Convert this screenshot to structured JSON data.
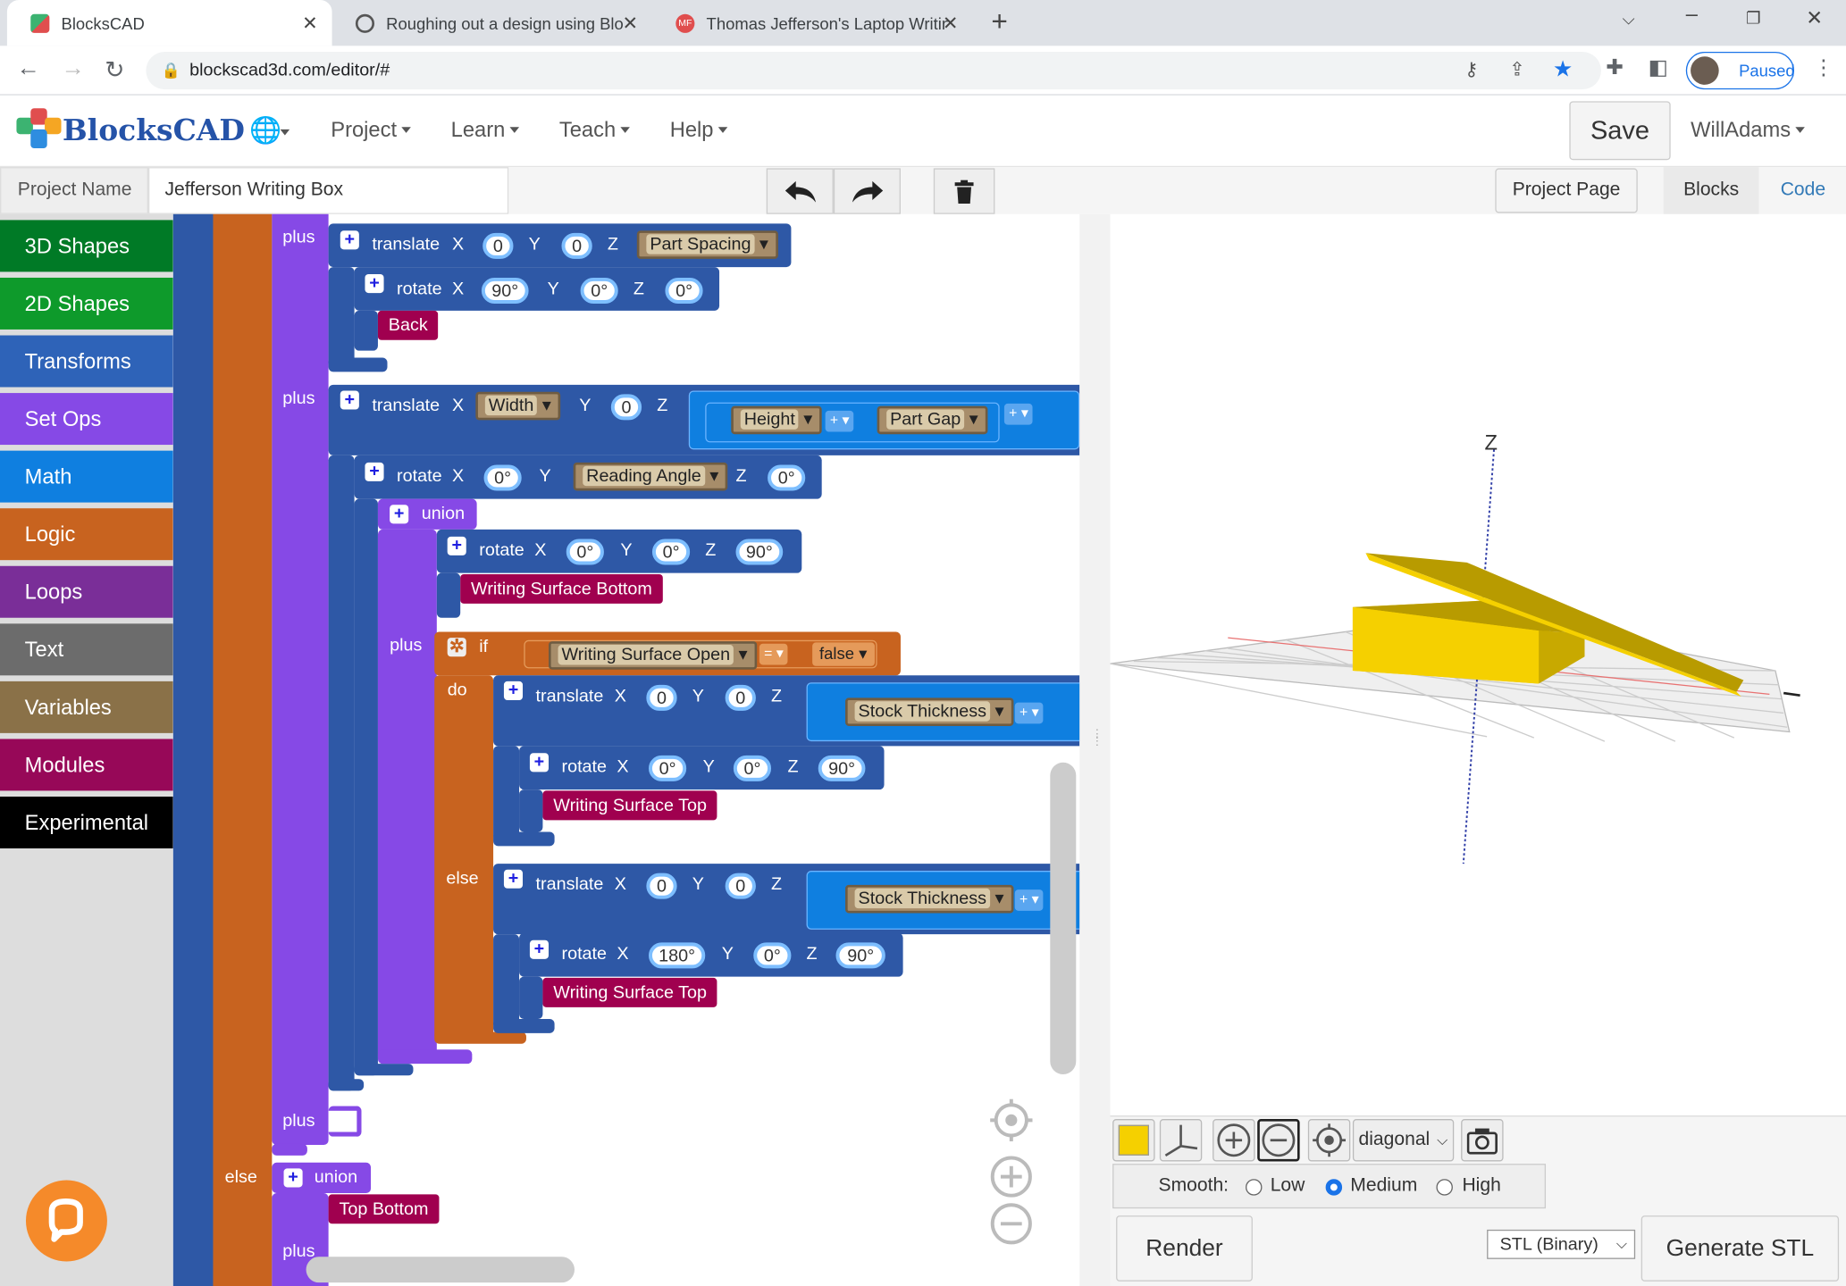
{
  "browser": {
    "tabs": [
      {
        "title": "BlocksCAD",
        "color": "#4c9be8"
      },
      {
        "title": "Roughing out a design using Blo",
        "color": "#777777"
      },
      {
        "title": "Thomas Jefferson's Laptop Writin",
        "color": "#e04e4e"
      }
    ],
    "fav_mf": "MF",
    "url": "blockscad3d.com/editor/#",
    "profile_status": "Paused"
  },
  "app": {
    "logo_text": "BlocksCAD",
    "menu": [
      "Project",
      "Learn",
      "Teach",
      "Help"
    ],
    "save_label": "Save",
    "user": "WillAdams"
  },
  "project": {
    "name_label": "Project Name",
    "name_value": "Jefferson Writing Box",
    "project_page": "Project Page",
    "blocks_tab": "Blocks",
    "code_tab": "Code"
  },
  "toolbox": [
    {
      "label": "3D Shapes",
      "color": "#007a26"
    },
    {
      "label": "2D Shapes",
      "color": "#0e9a2b"
    },
    {
      "label": "Transforms",
      "color": "#2e63b8"
    },
    {
      "label": "Set Ops",
      "color": "#8649e6"
    },
    {
      "label": "Math",
      "color": "#0f7fe0"
    },
    {
      "label": "Logic",
      "color": "#c8631f"
    },
    {
      "label": "Loops",
      "color": "#7a2e98"
    },
    {
      "label": "Text",
      "color": "#6c6c6c"
    },
    {
      "label": "Variables",
      "color": "#8a7148"
    },
    {
      "label": "Modules",
      "color": "#970858"
    },
    {
      "label": "Experimental",
      "color": "#000000"
    }
  ],
  "blocks": {
    "plus": "plus",
    "else": "else",
    "do": "do",
    "if": "if",
    "translate": "translate",
    "rotate": "rotate",
    "union": "union",
    "x": "X",
    "y": "Y",
    "z": "Z",
    "v0": "0",
    "deg0": "0°",
    "deg90": "90°",
    "deg180": "180°",
    "part_spacing": "Part Spacing",
    "back": "Back",
    "width": "Width",
    "height": "Height",
    "part_gap": "Part Gap",
    "reading_angle": "Reading Angle",
    "writing_surface_bottom": "Writing Surface Bottom",
    "writing_surface_open": "Writing Surface Open",
    "eq": "=",
    "false": "false",
    "stock_thickness": "Stock Thickness",
    "plus_op": "+",
    "writing_surface_top": "Writing Surface Top",
    "top_bottom": "Top Bottom"
  },
  "viewer": {
    "axis_z": "Z",
    "view_select": "diagonal",
    "smooth_label": "Smooth:",
    "smooth_options": [
      "Low",
      "Medium",
      "High"
    ],
    "smooth_selected": "Medium",
    "render_label": "Render",
    "format_select": "STL (Binary)",
    "generate_label": "Generate STL",
    "part_color": "#f5d000"
  }
}
